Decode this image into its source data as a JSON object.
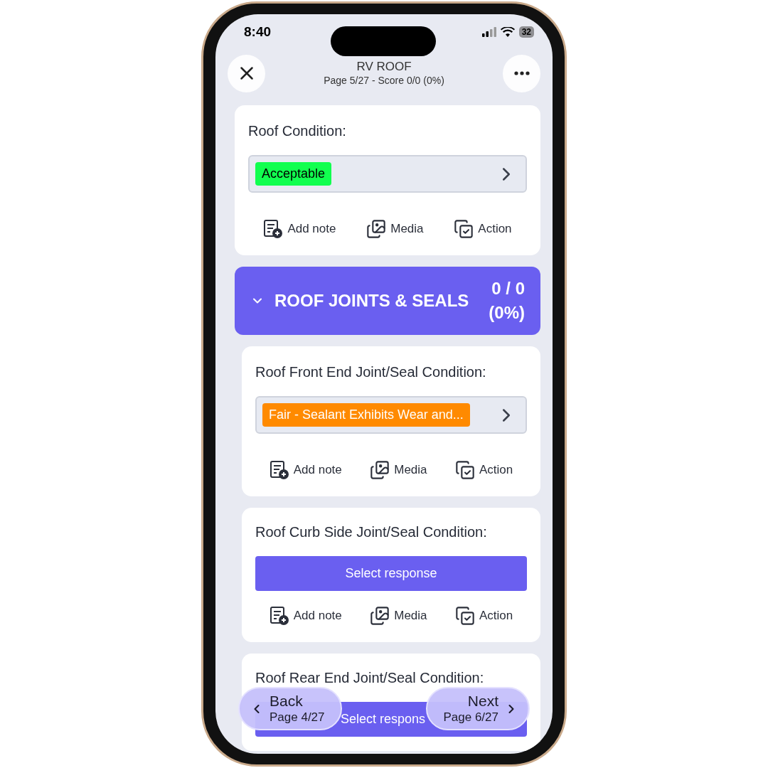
{
  "status_bar": {
    "time": "8:40",
    "battery": "32"
  },
  "header": {
    "title": "RV ROOF",
    "subtitle": "Page 5/27 - Score 0/0 (0%)"
  },
  "items": [
    {
      "kind": "question",
      "label": "Roof Condition:",
      "response": {
        "text": "Acceptable",
        "color": "#11ff4f"
      },
      "actions": [
        "Add note",
        "Media",
        "Action"
      ]
    },
    {
      "kind": "section",
      "title": "ROOF JOINTS & SEALS",
      "score": "0 / 0",
      "percent": "(0%)",
      "expanded": true
    },
    {
      "kind": "question",
      "label": "Roof Front End Joint/Seal Condition:",
      "response": {
        "text": "Fair - Sealant Exhibits Wear and...",
        "color": "#ff8a00"
      },
      "actions": [
        "Add note",
        "Media",
        "Action"
      ]
    },
    {
      "kind": "question",
      "label": "Roof Curb Side Joint/Seal Condition:",
      "select_button": "Select response",
      "actions": [
        "Add note",
        "Media",
        "Action"
      ]
    },
    {
      "kind": "question",
      "label": "Roof Rear End Joint/Seal Condition:",
      "select_button": "Select respons"
    }
  ],
  "nav": {
    "back": {
      "label": "Back",
      "page": "Page 4/27"
    },
    "next": {
      "label": "Next",
      "page": "Page 6/27"
    }
  }
}
